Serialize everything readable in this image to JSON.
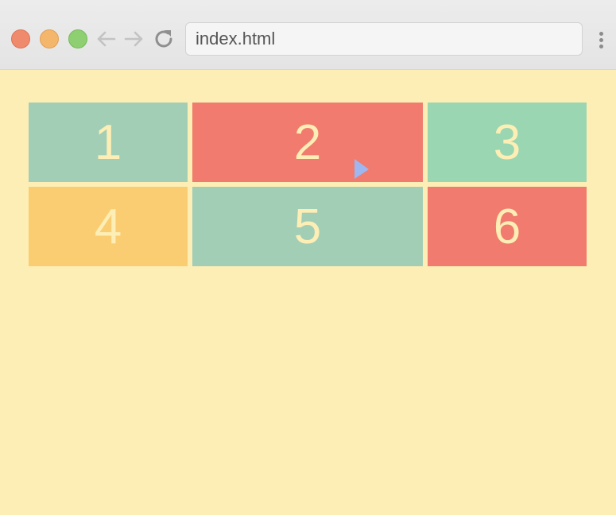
{
  "browser": {
    "address": "index.html",
    "buttons": {
      "back": "arrow-left-icon",
      "forward": "arrow-right-icon",
      "reload": "reload-icon",
      "menu": "more-vertical-icon"
    },
    "colors": {
      "chrome": "#e8e8e8",
      "close": "#f08a6c",
      "minimize": "#f4b66a",
      "zoom": "#8ecf72"
    }
  },
  "page": {
    "background": "#fdeeb5",
    "cells": [
      {
        "label": "1",
        "color": "#a2ceb6"
      },
      {
        "label": "2",
        "color": "#f07b6e"
      },
      {
        "label": "3",
        "color": "#9ad6b1"
      },
      {
        "label": "4",
        "color": "#fbcd72"
      },
      {
        "label": "5",
        "color": "#a2ceb6"
      },
      {
        "label": "6",
        "color": "#f07b6e"
      }
    ],
    "cursor_color": "#9fb7f0"
  }
}
